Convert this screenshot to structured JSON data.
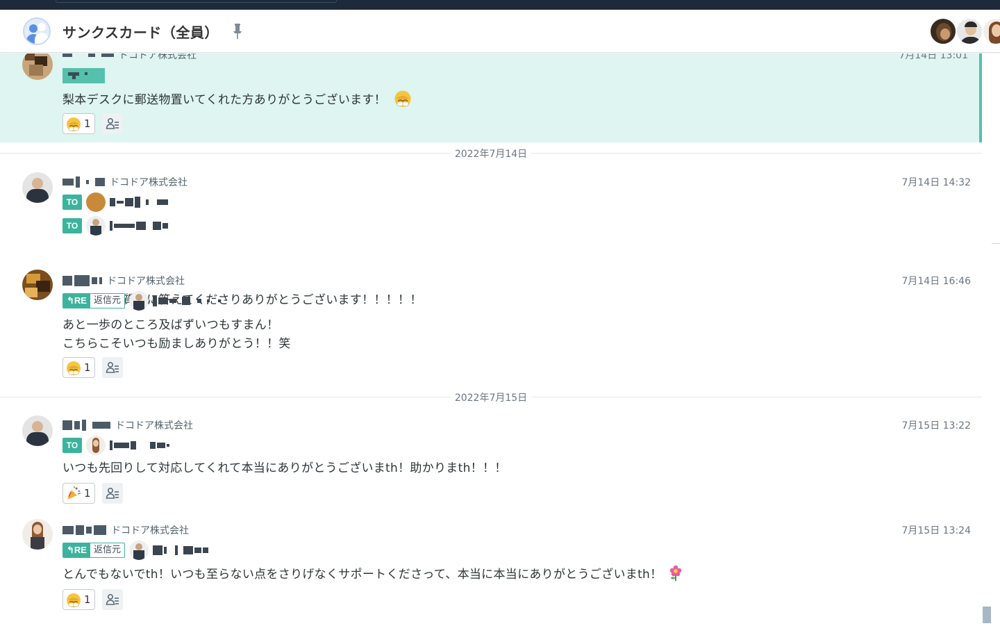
{
  "header": {
    "title": "サンクスカード（全員）",
    "room_icon": "group-icon",
    "pin_icon": "pin-icon",
    "member_avatars": 3
  },
  "colors": {
    "accent": "#3cb39c",
    "highlight_bg": "#def5f1",
    "header_bar": "#1c2a3a"
  },
  "timeline": {
    "highlighted_message": {
      "sender_company": "ドコドア株式会社",
      "time": "7月14日 13:01",
      "text": "梨本デスクに郵送物置いてくれた方ありがとうございます！",
      "reaction_count": "1"
    },
    "date_separators": [
      "2022年7月14日",
      "2022年7月15日"
    ],
    "messages": [
      {
        "company": "ドコドア株式会社",
        "time": "7月14日 14:32",
        "to_label": "TO",
        "text": "いつも快く質問に答えてくださりありがとうございます！！！！！"
      },
      {
        "company": "ドコドア株式会社",
        "time": "7月14日 16:46",
        "re_label": "RE",
        "re_source": "返信元",
        "text_line1": "あと一歩のところ及ばずいつもすまん！",
        "text_line2": "こちらこそいつも励ましありがとう！！笑",
        "reaction_count": "1"
      },
      {
        "company": "ドコドア株式会社",
        "time": "7月15日 13:22",
        "to_label": "TO",
        "text": "いつも先回りして対応してくれて本当にありがとうございまth！助かりまth！！！",
        "reaction_count": "1"
      },
      {
        "company": "ドコドア株式会社",
        "time": "7月15日 13:24",
        "re_label": "RE",
        "re_source": "返信元",
        "text": "とんでもないでth！いつも至らない点をさりげなくサポートくださって、本当に本当にありがとうございまth！",
        "reaction_count": "1"
      }
    ]
  }
}
